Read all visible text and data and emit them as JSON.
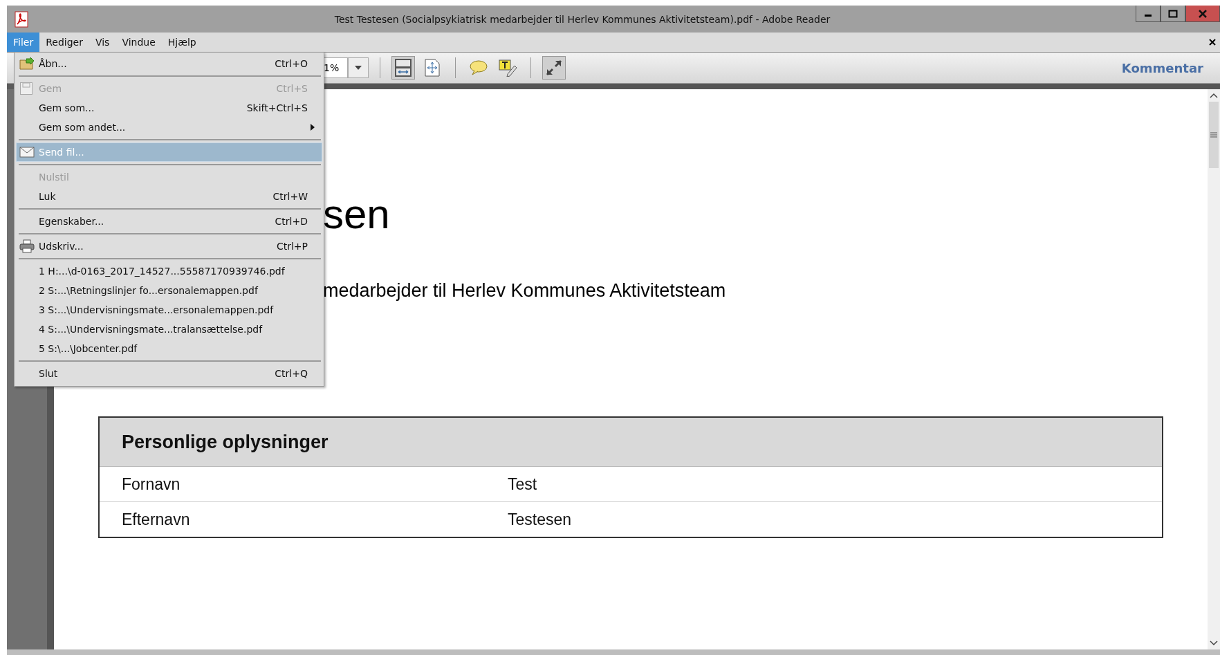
{
  "window": {
    "title": "Test Testesen (Socialpsykiatrisk medarbejder til Herlev Kommunes Aktivitetsteam).pdf - Adobe Reader"
  },
  "menu_bar": [
    {
      "label": "Filer",
      "selected": true
    },
    {
      "label": "Rediger",
      "selected": false
    },
    {
      "label": "Vis",
      "selected": false
    },
    {
      "label": "Vindue",
      "selected": false
    },
    {
      "label": "Hjælp",
      "selected": false
    }
  ],
  "file_menu": [
    [
      {
        "label": "Åbn...",
        "shortcut": "Ctrl+O",
        "disabled": false,
        "selected": false,
        "submenu": false
      }
    ],
    [
      {
        "label": "Gem",
        "shortcut": "Ctrl+S",
        "disabled": true,
        "selected": false,
        "submenu": false
      },
      {
        "label": "Gem som...",
        "shortcut": "Skift+Ctrl+S",
        "disabled": false,
        "selected": false,
        "submenu": false
      },
      {
        "label": "Gem som andet...",
        "disabled": false,
        "selected": false,
        "submenu": true
      }
    ],
    [
      {
        "label": "Send fil...",
        "disabled": false,
        "selected": true,
        "submenu": false
      }
    ],
    [
      {
        "label": "Nulstil",
        "disabled": true,
        "selected": false,
        "submenu": false
      },
      {
        "label": "Luk",
        "shortcut": "Ctrl+W",
        "disabled": false,
        "selected": false,
        "submenu": false
      }
    ],
    [
      {
        "label": "Egenskaber...",
        "shortcut": "Ctrl+D",
        "disabled": false,
        "selected": false,
        "submenu": false
      }
    ],
    [
      {
        "label": "Udskriv...",
        "shortcut": "Ctrl+P",
        "disabled": false,
        "selected": false,
        "submenu": false
      }
    ],
    [
      {
        "label": "1 H:...\\d-0163_2017_14527...55587170939746.pdf",
        "disabled": false,
        "selected": false,
        "submenu": false
      },
      {
        "label": "2 S:...\\Retningslinjer fo...ersonalemappen.pdf",
        "disabled": false,
        "selected": false,
        "submenu": false
      },
      {
        "label": "3 S:...\\Undervisningsmate...ersonalemappen.pdf",
        "disabled": false,
        "selected": false,
        "submenu": false
      },
      {
        "label": "4 S:...\\Undervisningsmate...tralansættelse.pdf",
        "disabled": false,
        "selected": false,
        "submenu": false
      },
      {
        "label": "5 S:\\...\\Jobcenter.pdf",
        "disabled": false,
        "selected": false,
        "submenu": false
      }
    ],
    [
      {
        "label": "Slut",
        "shortcut": "Ctrl+Q",
        "disabled": false,
        "selected": false,
        "submenu": false
      }
    ]
  ],
  "toolbar": {
    "zoom": "1%",
    "comment_button": "Kommentar"
  },
  "document": {
    "heading": "sen",
    "subtitle": "medarbejder til Herlev Kommunes Aktivitetsteam",
    "table": {
      "title": "Personlige oplysninger",
      "rows": [
        [
          "Fornavn",
          "Test"
        ],
        [
          "Efternavn",
          "Testesen"
        ]
      ]
    }
  }
}
